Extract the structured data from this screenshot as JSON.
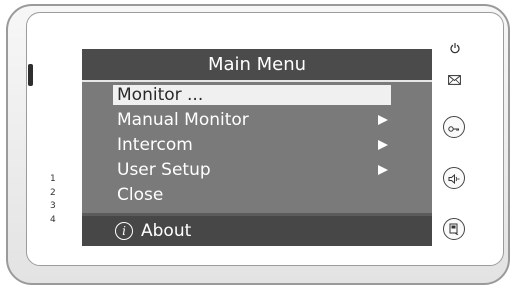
{
  "screen": {
    "title": "Main Menu",
    "menu_items": [
      {
        "label": "Monitor ...",
        "has_submenu": false,
        "selected": true
      },
      {
        "label": "Manual Monitor",
        "has_submenu": true,
        "selected": false
      },
      {
        "label": "Intercom",
        "has_submenu": true,
        "selected": false
      },
      {
        "label": "User Setup",
        "has_submenu": true,
        "selected": false
      },
      {
        "label": "Close",
        "has_submenu": false,
        "selected": false
      }
    ],
    "about_label": "About",
    "about_icon": "info-icon"
  },
  "side_numbers": [
    "1",
    "2",
    "3",
    "4"
  ],
  "indicators": {
    "power": "power-icon",
    "message": "envelope-icon"
  },
  "buttons": [
    {
      "name": "unlock-key-button",
      "icon": "key-icon"
    },
    {
      "name": "talk-button",
      "icon": "speaker-icon"
    },
    {
      "name": "menu-button",
      "icon": "menu-icon"
    }
  ]
}
